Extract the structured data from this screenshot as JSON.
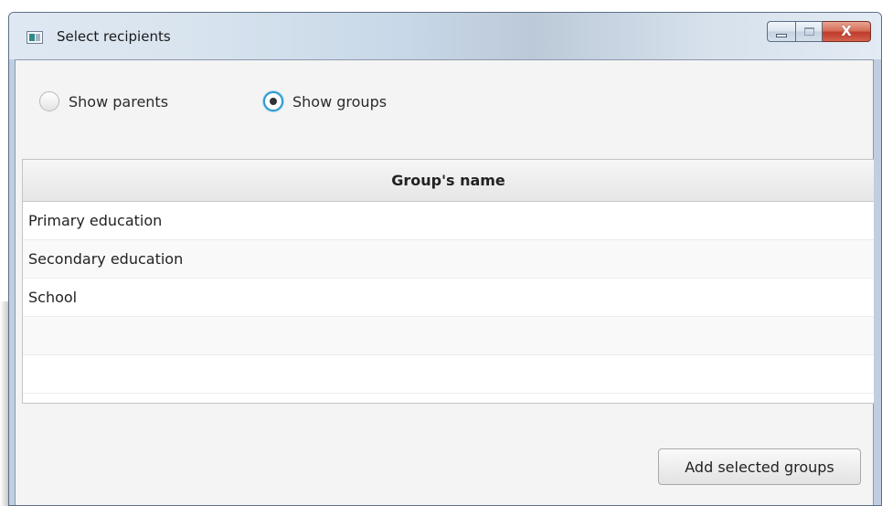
{
  "window": {
    "title": "Select recipients",
    "close_symbol": "X"
  },
  "filter": {
    "options": [
      {
        "label": "Show parents",
        "selected": false
      },
      {
        "label": "Show groups",
        "selected": true
      }
    ]
  },
  "table": {
    "column_header": "Group's name",
    "rows": [
      "Primary education",
      "Secondary education",
      "School",
      "",
      ""
    ]
  },
  "actions": {
    "add_label": "Add selected groups"
  },
  "icons": {
    "app": "window-app-icon",
    "minimize": "minimize-icon",
    "maximize": "maximize-icon",
    "close": "close-icon"
  },
  "colors": {
    "radio_selected": "#2e9ad0",
    "close_button": "#c0392b"
  }
}
